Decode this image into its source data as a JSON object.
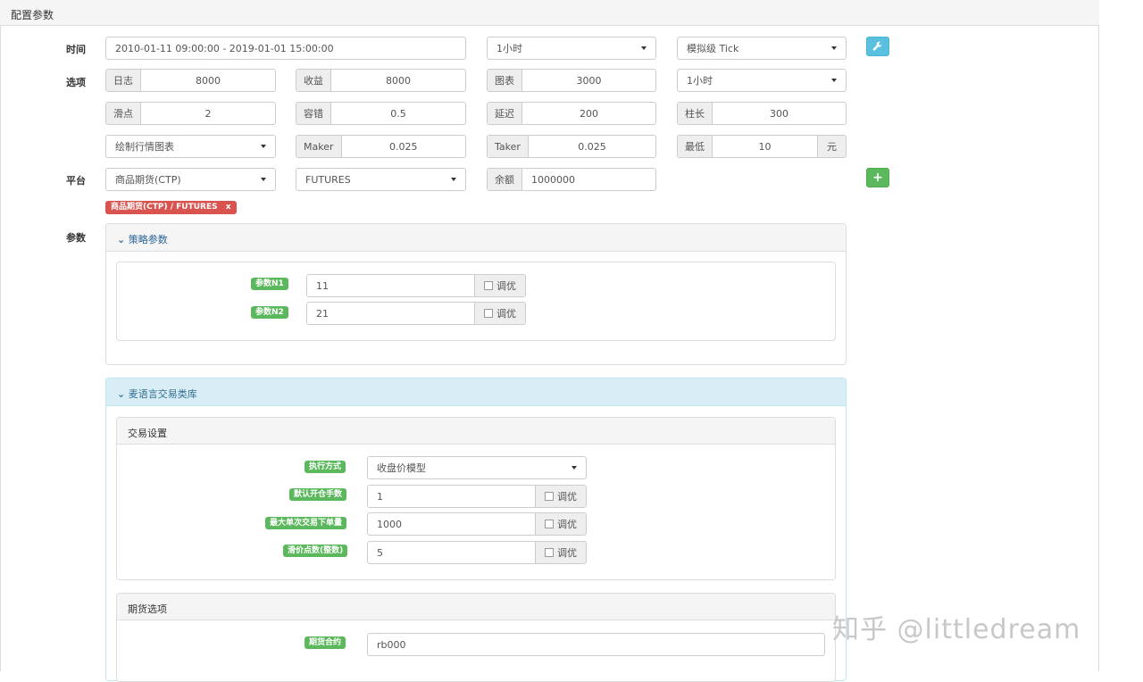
{
  "panel_title": "配置参数",
  "labels": {
    "time": "时间",
    "options": "选项",
    "platform": "平台",
    "params": "参数"
  },
  "time": {
    "range": "2010-01-11 09:00:00 - 2019-01-01 15:00:00",
    "period": "1小时",
    "mode": "模拟级 Tick"
  },
  "options": {
    "log_label": "日志",
    "log_value": "8000",
    "profit_label": "收益",
    "profit_value": "8000",
    "chart_label": "图表",
    "chart_value": "3000",
    "period2": "1小时",
    "slippage_label": "滑点",
    "slippage_value": "2",
    "tolerance_label": "容错",
    "tolerance_value": "0.5",
    "delay_label": "延迟",
    "delay_value": "200",
    "bar_label": "柱长",
    "bar_value": "300",
    "draw_chart": "绘制行情图表",
    "maker_label": "Maker",
    "maker_value": "0.025",
    "taker_label": "Taker",
    "taker_value": "0.025",
    "min_label": "最低",
    "min_value": "10",
    "min_unit": "元"
  },
  "platform": {
    "exchange": "商品期货(CTP)",
    "market": "FUTURES",
    "balance_label": "余额",
    "balance_value": "1000000",
    "tag": "商品期货(CTP) / FUTURES",
    "tag_close": "x"
  },
  "strategy": {
    "title": "策略参数",
    "params": [
      {
        "label": "参数N1",
        "value": "11",
        "opt": "调优"
      },
      {
        "label": "参数N2",
        "value": "21",
        "opt": "调优"
      }
    ]
  },
  "mylang": {
    "title": "麦语言交易类库",
    "trade_title": "交易设置",
    "exec_label": "执行方式",
    "exec_value": "收盘价模型",
    "open_label": "默认开仓手数",
    "open_value": "1",
    "maxorder_label": "最大单次交易下单量",
    "maxorder_value": "1000",
    "slip_label": "滑价点数(整数)",
    "slip_value": "5",
    "opt": "调优",
    "futures_title": "期货选项",
    "contract_label": "期货合约",
    "contract_value": "rb000"
  },
  "watermark": "知乎 @littledream",
  "icons": {
    "wrench": "wrench-icon",
    "plus": "plus-icon",
    "chevron": "chevron-down-icon"
  },
  "colors": {
    "info": "#5bc0de",
    "success": "#5cb85c",
    "danger": "#d9534f"
  }
}
